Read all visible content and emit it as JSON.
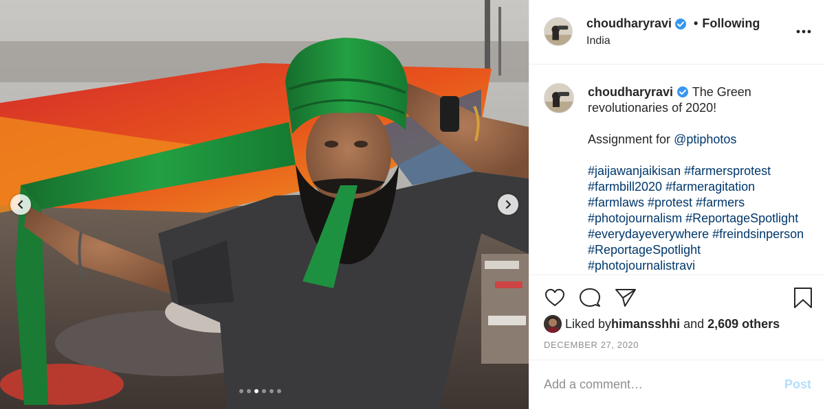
{
  "post": {
    "username": "choudharyravi",
    "separator": "•",
    "follow_status": "Following",
    "location": "India"
  },
  "caption": {
    "username": "choudharyravi",
    "line1": "The Green revolutionaries of 2020!",
    "assignment_prefix": "Assignment for ",
    "mention": "@ptiphotos",
    "hashtag_lines": [
      "#jaijawanjaikisan #farmersprotest",
      "#farmbill2020 #farmeragitation",
      "#farmlaws #protest #farmers",
      "#photojournalism #ReportageSpotlight",
      "#everydayeverywhere #freindsinperson",
      "#ReportageSpotlight",
      "#photojournalistravi"
    ]
  },
  "likes": {
    "prefix": "Liked by ",
    "user": "himansshhi",
    "conjunction": " and ",
    "others": "2,609 others"
  },
  "date": "DECEMBER 27, 2020",
  "comment": {
    "placeholder": "Add a comment…",
    "post_label": "Post"
  },
  "carousel": {
    "total_slides": 6,
    "active_slide": 3
  },
  "icons": {
    "verified": "verified-badge-icon",
    "more": "more-options-icon",
    "like": "heart-icon",
    "comment": "comment-bubble-icon",
    "share": "paper-plane-icon",
    "save": "bookmark-icon",
    "prev": "chevron-left-icon",
    "next": "chevron-right-icon"
  },
  "colors": {
    "verified_blue": "#3897f0",
    "link_blue": "#00376b",
    "post_disabled": "#b2dffc",
    "muted_gray": "#8e8e8e",
    "turban_green": "#1f8a3a"
  }
}
